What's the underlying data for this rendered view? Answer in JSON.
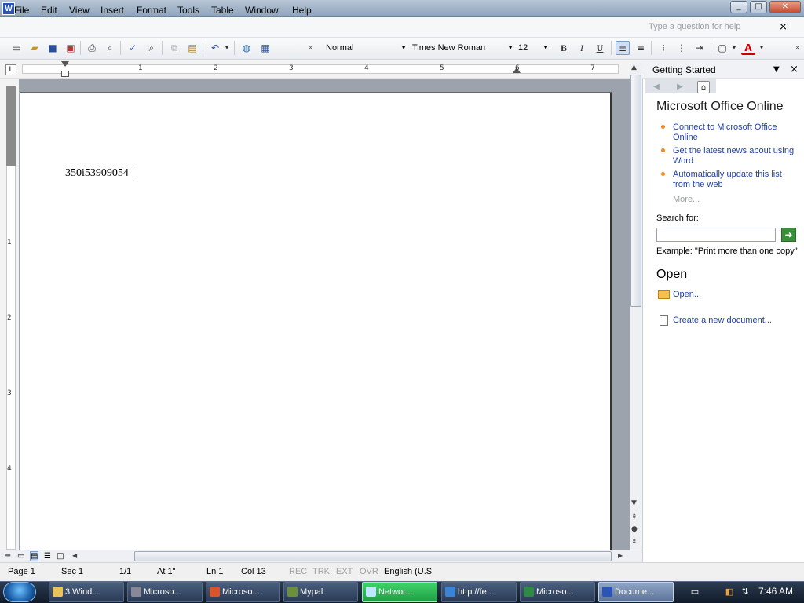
{
  "window": {
    "title_icon": "W",
    "minimize": "_",
    "maximize": "□",
    "close": "✕"
  },
  "menubar": {
    "items": [
      "File",
      "Edit",
      "View",
      "Insert",
      "Format",
      "Tools",
      "Table",
      "Window",
      "Help"
    ],
    "help_placeholder": "Type a question for help",
    "help_close": "×"
  },
  "toolbar": {
    "style": "Normal",
    "font": "Times New Roman",
    "size": "12",
    "bold": "B",
    "italic": "I",
    "underline": "U"
  },
  "ruler": {
    "numbers": [
      "1",
      "2",
      "3",
      "4",
      "5",
      "6",
      "7"
    ],
    "vnumbers": [
      "1",
      "2",
      "3",
      "4"
    ]
  },
  "document": {
    "text": "350i53909054"
  },
  "task_pane": {
    "title": "Getting Started",
    "section_online": "Microsoft Office Online",
    "links": [
      "Connect to Microsoft Office Online",
      "Get the latest news about using Word",
      "Automatically update this list from the web"
    ],
    "more": "More...",
    "search_label": "Search for:",
    "example": "Example:  \"Print more than one copy\"",
    "section_open": "Open",
    "open_link": "Open...",
    "new_link": "Create a new document..."
  },
  "statusbar": {
    "page": "Page  1",
    "sec": "Sec  1",
    "pages": "1/1",
    "at": "At  1\"",
    "ln": "Ln  1",
    "col": "Col  13",
    "rec": "REC",
    "trk": "TRK",
    "ext": "EXT",
    "ovr": "OVR",
    "lang": "English (U.S"
  },
  "taskbar": {
    "tasks": [
      "3 Wind...",
      "Microso...",
      "Microso...",
      "Mypal",
      "Networ...",
      "http://fe...",
      "Microso...",
      "Docume..."
    ],
    "clock": "7:46 AM"
  },
  "colors": {
    "accent": "#1e3fa8",
    "bullet": "#f08a24",
    "active_task": "#1f9d44"
  }
}
